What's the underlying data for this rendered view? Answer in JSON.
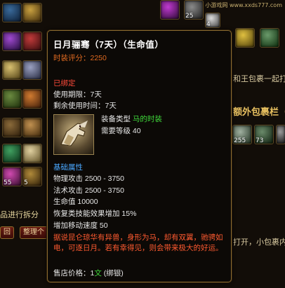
{
  "background": {
    "watermark": "小游戏网 www.xxds777.com",
    "slot_counts": {
      "a": "25",
      "b": "4",
      "c": "255",
      "d": "73",
      "e": "55",
      "f": "5"
    },
    "right_texts": {
      "line1": "和王包裹一起打开，小包裹内物",
      "panel_title": "额外包裹栏（一",
      "line2": "打开，小包裹内物"
    },
    "bottom_left_text": "品进行拆分",
    "btn_left": "回",
    "btn_sort": "整理个"
  },
  "tooltip": {
    "title": "日月骊骞（7天）（生命值）",
    "score_label": "时装评分：",
    "score_value": "2250",
    "bound": "已绑定",
    "period": "使用期限：7天",
    "remaining": "剩余使用时间：7天",
    "equip_type_label": "装备类型",
    "equip_type_value": "马的时装",
    "level_req": "需要等级 40",
    "basic_attr_header": "基础属性",
    "attrs": [
      "物理攻击 2500 - 3750",
      "法术攻击 2500 - 3750",
      "生命值 10000",
      "恢复类技能效果增加  15%",
      "增加移动速度  50"
    ],
    "description": "据说昆仑琼华有异兽，身形为马，却有双翼，驰骋如电，可逐日月。若有幸得见，则会带来极大的好运。",
    "price_label": "售店价格：",
    "price_value": "1",
    "price_unit": "文",
    "price_suffix": " (绑银)"
  },
  "colors": {
    "title": "#ffffff",
    "accent_orange": "#e06a20",
    "green": "#3fd83a",
    "blue": "#4aa8ff",
    "red": "#ff4a3a"
  },
  "icons": [
    "mount-horse-icon"
  ]
}
